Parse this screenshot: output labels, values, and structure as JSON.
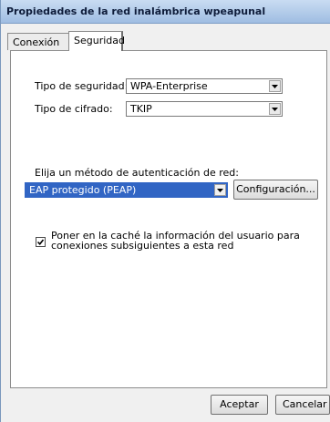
{
  "window": {
    "title": "Propiedades de la red inalámbrica wpeapunal"
  },
  "tabs": [
    {
      "label": "Conexión",
      "selected": false
    },
    {
      "label": "Seguridad",
      "selected": true
    }
  ],
  "security": {
    "type_label": "Tipo de seguridad:",
    "type_value": "WPA-Enterprise",
    "cipher_label": "Tipo de cifrado:",
    "cipher_value": "TKIP",
    "auth_label": "Elija un método de autenticación de red:",
    "auth_value": "EAP protegido (PEAP)",
    "config_button": "Configuración...",
    "cache_checkbox": {
      "checked": true,
      "line1": "Poner en la caché la información del usuario para",
      "line2": "conexiones subsiguientes a esta red"
    }
  },
  "footer": {
    "ok_button": "Aceptar",
    "cancel_button": "Cancelar"
  },
  "colors": {
    "selection": "#3165c4",
    "titlebar": "#9fbde2"
  },
  "icons": {
    "dropdown": "chevron-down-icon",
    "check": "checkmark-icon"
  }
}
